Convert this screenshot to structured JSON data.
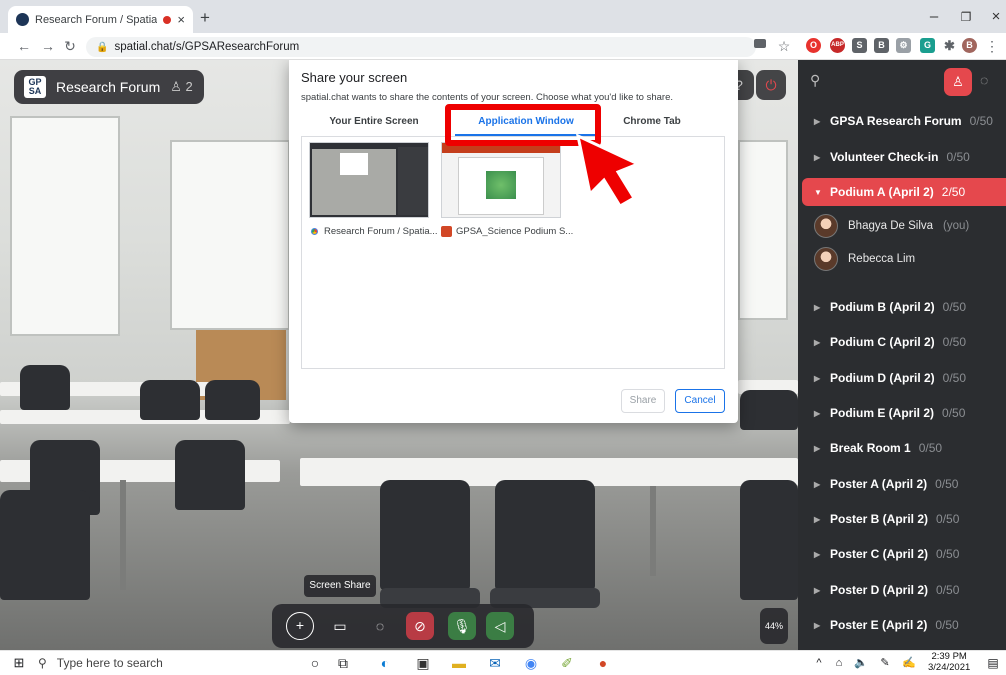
{
  "browser": {
    "tab_title": "Research Forum / SpatialCha",
    "tab_close": "×",
    "new_tab": "+",
    "url": "spatial.chat/s/GPSAResearchForum",
    "window_controls": {
      "minimize": "–",
      "restore": "❐",
      "close": "×"
    }
  },
  "room": {
    "logo_text": "GP\nSA",
    "name": "Research Forum",
    "participant_count": "2"
  },
  "dialog": {
    "title": "Share your screen",
    "subtitle": "spatial.chat wants to share the contents of your screen. Choose what you'd like to share.",
    "tabs": [
      "Your Entire Screen",
      "Application Window",
      "Chrome Tab"
    ],
    "selected_tab": "Application Window",
    "windows": [
      {
        "label": "Research Forum / Spatia...",
        "icon": "chrome-icon"
      },
      {
        "label": "GPSA_Science Podium S...",
        "icon": "powerpoint-icon"
      }
    ],
    "share_label": "Share",
    "cancel_label": "Cancel"
  },
  "sidebar": {
    "sections": [
      {
        "name": "GPSA Research Forum",
        "count": "0/50",
        "active": false
      },
      {
        "name": "Volunteer Check-in",
        "count": "0/50",
        "active": false
      },
      {
        "name": "Podium A (April 2)",
        "count": "2/50",
        "active": true
      },
      {
        "name": "Podium B (April 2)",
        "count": "0/50",
        "active": false
      },
      {
        "name": "Podium C (April 2)",
        "count": "0/50",
        "active": false
      },
      {
        "name": "Podium D (April 2)",
        "count": "0/50",
        "active": false
      },
      {
        "name": "Podium E (April 2)",
        "count": "0/50",
        "active": false
      },
      {
        "name": "Break Room 1",
        "count": "0/50",
        "active": false
      },
      {
        "name": "Poster A (April 2)",
        "count": "0/50",
        "active": false
      },
      {
        "name": "Poster B (April 2)",
        "count": "0/50",
        "active": false
      },
      {
        "name": "Poster C (April 2)",
        "count": "0/50",
        "active": false
      },
      {
        "name": "Poster D (April 2)",
        "count": "0/50",
        "active": false
      },
      {
        "name": "Poster E (April 2)",
        "count": "0/50",
        "active": false
      }
    ],
    "members": [
      {
        "name": "Bhagya De Silva",
        "tag": "(you)"
      },
      {
        "name": "Rebecca Lim",
        "tag": ""
      }
    ]
  },
  "toolbar": {
    "tooltip": "Screen Share",
    "zoom": "44%"
  },
  "taskbar": {
    "search_placeholder": "Type here to search",
    "time": "2:39 PM",
    "date": "3/24/2021"
  },
  "colors": {
    "accent": "#e5484d",
    "dialog_blue": "#1a73e8",
    "highlight": "#ee0000"
  }
}
